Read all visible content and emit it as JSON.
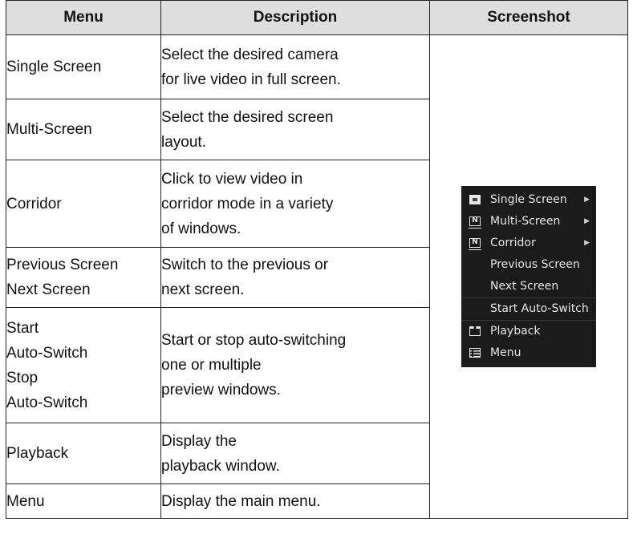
{
  "headers": {
    "menu": "Menu",
    "description": "Description",
    "screenshot": "Screenshot"
  },
  "rows": [
    {
      "menu": [
        "Single Screen"
      ],
      "description": [
        "Select the desired camera",
        "for live video in full screen."
      ]
    },
    {
      "menu": [
        "Multi-Screen"
      ],
      "description": [
        "Select the desired screen",
        "layout."
      ]
    },
    {
      "menu": [
        "Corridor"
      ],
      "description": [
        "Click to view video in",
        "corridor mode in a variety",
        "of windows."
      ]
    },
    {
      "menu": [
        "Previous Screen",
        "Next Screen"
      ],
      "description": [
        "Switch to the previous or",
        "next screen."
      ]
    },
    {
      "menu": [
        "Start",
        "Auto-Switch",
        "Stop",
        "Auto-Switch"
      ],
      "description": [
        "Start or stop auto-switching",
        "one or multiple",
        "preview windows."
      ]
    },
    {
      "menu": [
        "Playback"
      ],
      "description": [
        "Display the",
        "playback window."
      ]
    },
    {
      "menu": [
        "Menu"
      ],
      "description": [
        "Display the main menu."
      ]
    }
  ],
  "context_menu": {
    "items": [
      {
        "label": "Single Screen",
        "icon": "camera-icon",
        "submenu": true
      },
      {
        "label": "Multi-Screen",
        "icon": "multi-screen-icon",
        "submenu": true
      },
      {
        "label": "Corridor",
        "icon": "corridor-icon",
        "submenu": true
      },
      {
        "label": "Previous Screen",
        "icon": "",
        "submenu": false
      },
      {
        "label": "Next Screen",
        "icon": "",
        "submenu": false
      },
      {
        "label": "Start Auto-Switch",
        "icon": "",
        "submenu": false
      },
      {
        "label": "Playback",
        "icon": "playback-icon",
        "submenu": false
      },
      {
        "label": "Menu",
        "icon": "menu-list-icon",
        "submenu": false
      }
    ]
  }
}
